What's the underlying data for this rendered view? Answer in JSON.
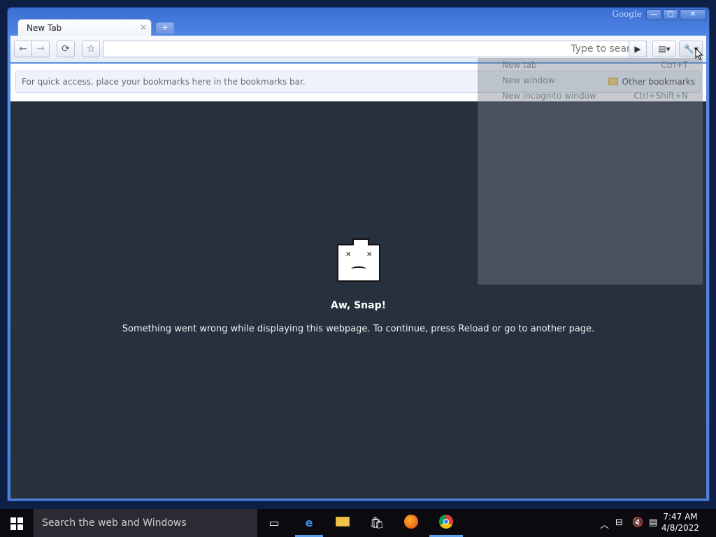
{
  "window": {
    "brand": "Google",
    "controls": {
      "min": "—",
      "max": "▢",
      "close": "✕"
    },
    "tab_title": "New Tab",
    "tab_close": "×",
    "new_tab": "+"
  },
  "toolbar": {
    "back": "←",
    "forward": "→",
    "reload": "⟳",
    "star": "☆",
    "omnibox_hint": "Type to search",
    "go": "▶",
    "page_menu": "▤▾",
    "wrench": "🔧▾"
  },
  "bookmarks": {
    "hint": "For quick access, place your bookmarks here in the bookmarks bar.",
    "other": "Other bookmarks"
  },
  "error": {
    "title": "Aw, Snap!",
    "message": "Something went wrong while displaying this webpage. To continue, press Reload or go to another page."
  },
  "menu": [
    {
      "label": "New tab",
      "shortcut": "Ctrl+T"
    },
    {
      "label": "New window",
      "shortcut": ""
    },
    {
      "label": "New incognito window",
      "shortcut": "Ctrl+Shift+N"
    },
    {
      "label": "Always show bookmarks bar",
      "shortcut": "Ctrl+B"
    },
    {
      "label": "History",
      "shortcut": "Ctrl+H"
    },
    {
      "label": "Bookmark manager",
      "shortcut": "Ctrl+Shift+B"
    },
    {
      "label": "Downloads",
      "shortcut": "Ctrl+J"
    },
    {
      "label": "Clear browsing data...",
      "shortcut": ""
    },
    {
      "label": "Import bookmarks & settings...",
      "shortcut": ""
    },
    {
      "label": "Options",
      "shortcut": ""
    },
    {
      "label": "About Google Chrome",
      "shortcut": ""
    },
    {
      "label": "Help",
      "shortcut": "F1"
    },
    {
      "label": "Exit",
      "shortcut": ""
    }
  ],
  "taskbar": {
    "search_placeholder": "Search the web and Windows",
    "time": "7:47 AM",
    "date": "4/8/2022"
  },
  "colors": {
    "content_bg": "#27313e",
    "frame": "#4a7fe0",
    "taskbar": "#0b0b0f",
    "accent": "#5c9ded"
  }
}
